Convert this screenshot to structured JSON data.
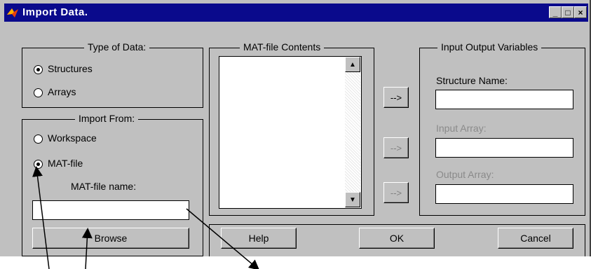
{
  "window": {
    "title": "Import Data.",
    "controls": {
      "minimize": "_",
      "maximize": "□",
      "close": "×"
    }
  },
  "type_of_data": {
    "legend": "Type of Data:",
    "options": [
      "Structures",
      "Arrays"
    ],
    "selected": "Structures"
  },
  "import_from": {
    "legend": "Import From:",
    "options": [
      "Workspace",
      "MAT-file"
    ],
    "selected": "MAT-file",
    "mat_file_name_label": "MAT-file name:",
    "mat_file_name_value": "",
    "browse": "Browse"
  },
  "mat_contents": {
    "legend": "MAT-file Contents",
    "items": []
  },
  "transfer_buttons": [
    "-->",
    "-->",
    "-->"
  ],
  "io_vars": {
    "legend": "Input Output Variables",
    "structure_name": "Structure Name:",
    "input_array": "Input Array:",
    "output_array": "Output Array:"
  },
  "footer": {
    "help": "Help",
    "ok": "OK",
    "cancel": "Cancel"
  },
  "icons": {
    "title_icon": "matlab-logo-icon",
    "scroll_up": "scroll-up-arrow-icon",
    "scroll_down": "scroll-down-arrow-icon"
  }
}
